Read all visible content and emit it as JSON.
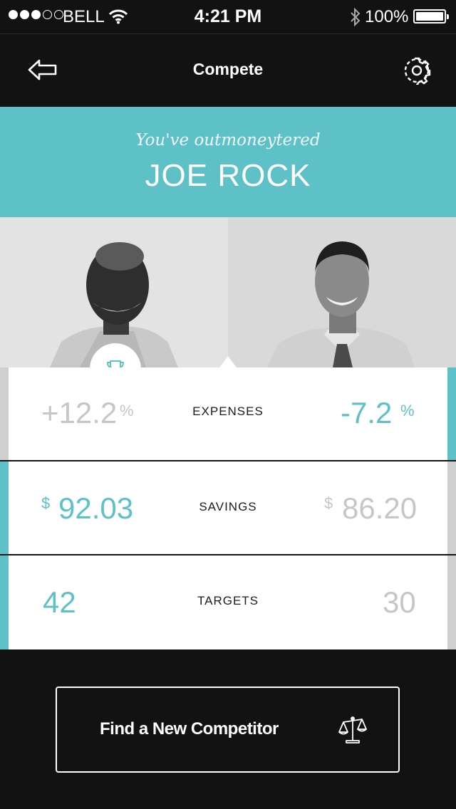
{
  "status_bar": {
    "carrier": "BELL",
    "time": "4:21 PM",
    "battery": "100%"
  },
  "nav": {
    "title": "Compete",
    "icons": [
      "back-arrow-icon",
      "gear-icon"
    ]
  },
  "banner": {
    "subtitle": "You've outmoneytered",
    "competitor_name": "JOE ROCK"
  },
  "stats": [
    {
      "label": "EXPENSES",
      "left": {
        "value": "+12.2",
        "unit": "%"
      },
      "right": {
        "value": "-7.2",
        "unit": "%"
      }
    },
    {
      "label": "SAVINGS",
      "left": {
        "value": "92.03",
        "unit": "$"
      },
      "right": {
        "value": "86.20",
        "unit": "$"
      }
    },
    {
      "label": "TARGETS",
      "left": {
        "value": "42",
        "unit": ""
      },
      "right": {
        "value": "30",
        "unit": ""
      }
    }
  ],
  "cta": {
    "label": "Find a New Competitor",
    "icon": "balance-scale-icon"
  },
  "colors": {
    "accent": "#5fc1c8",
    "background": "#121212",
    "muted": "#c6c6c6"
  }
}
